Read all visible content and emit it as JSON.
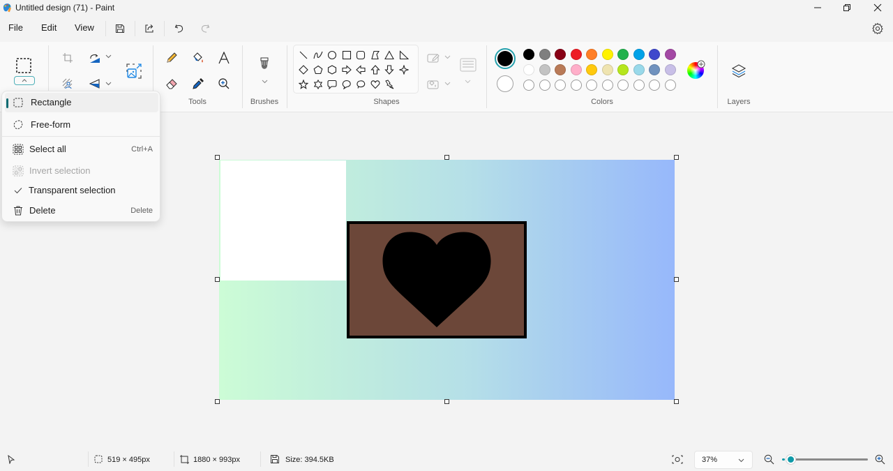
{
  "window": {
    "title": "Untitled design (71) - Paint",
    "controls": [
      "minimize",
      "restore",
      "close"
    ]
  },
  "menubar": {
    "items": [
      {
        "label": "File"
      },
      {
        "label": "Edit"
      },
      {
        "label": "View"
      }
    ],
    "quick_actions": [
      "save-icon",
      "share-icon",
      "undo-icon",
      "redo-icon"
    ]
  },
  "ribbon": {
    "groups": {
      "tools": "Tools",
      "brushes": "Brushes",
      "shapes": "Shapes",
      "colors": "Colors",
      "layers": "Layers"
    },
    "colors": {
      "primary": "#000000",
      "secondary": "#ffffff",
      "palette_row1": [
        "#000000",
        "#7f7f7f",
        "#880015",
        "#ed1c24",
        "#ff7f27",
        "#fff200",
        "#22b14c",
        "#00a2e8",
        "#3f48cc",
        "#a349a4"
      ],
      "palette_row2": [
        "#ffffff",
        "#c3c3c3",
        "#b97a57",
        "#ffaec9",
        "#ffc90e",
        "#efe4b0",
        "#b5e61d",
        "#99d9ea",
        "#7092be",
        "#c8bfe7"
      ],
      "custom_slots": 10
    },
    "shapes": [
      "line",
      "curve",
      "oval",
      "rectangle",
      "rounded-rectangle",
      "polygon",
      "triangle",
      "right-triangle",
      "diamond",
      "pentagon",
      "hexagon",
      "right-arrow",
      "left-arrow",
      "up-arrow",
      "down-arrow",
      "four-point-star",
      "five-point-star",
      "six-point-star",
      "rounded-callout",
      "oval-callout",
      "cloud-callout",
      "heart",
      "lightning"
    ]
  },
  "selection_menu": {
    "items": [
      {
        "label": "Rectangle",
        "shortcut": "",
        "active": true
      },
      {
        "label": "Free-form",
        "shortcut": ""
      },
      {
        "label": "Select all",
        "shortcut": "Ctrl+A"
      },
      {
        "label": "Invert selection",
        "shortcut": "",
        "disabled": true
      },
      {
        "label": "Transparent selection",
        "shortcut": "",
        "checked": true
      },
      {
        "label": "Delete",
        "shortcut": "Delete"
      }
    ]
  },
  "statusbar": {
    "selection_size": "519 × 495px",
    "canvas_size": "1880 × 993px",
    "file_size": "Size: 394.5KB",
    "zoom": "37%",
    "zoom_slider_fraction": 0.04
  }
}
